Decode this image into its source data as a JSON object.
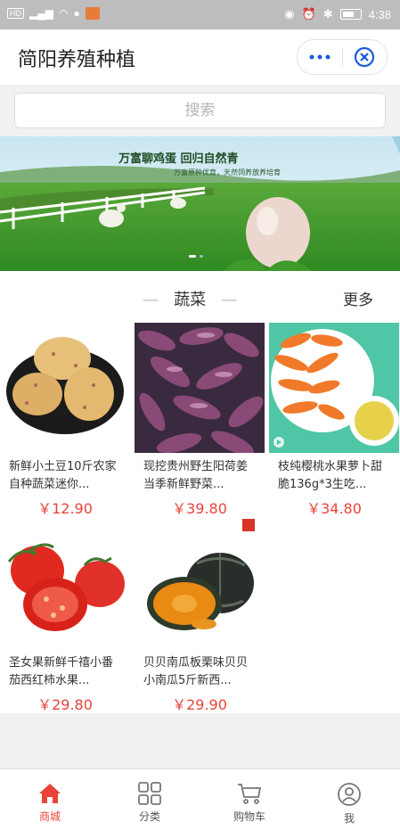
{
  "status_bar": {
    "time": "4:38",
    "left_badge": "HD"
  },
  "header": {
    "title": "简阳养殖种植",
    "more_icon": "ellipsis-icon",
    "close_icon": "close-circle-icon"
  },
  "search": {
    "placeholder": "搜索"
  },
  "banner": {
    "headline": "万富聊鸡蛋 回归自然青",
    "subline": "万富原种优育，天然饲养放养培育"
  },
  "section": {
    "title": "蔬菜",
    "more_label": "更多"
  },
  "products": [
    {
      "name": "新鲜小土豆10斤农家自种蔬菜迷你...",
      "price": "￥12.90"
    },
    {
      "name": "现挖贵州野生阳荷姜当季新鲜野菜...",
      "price": "￥39.80"
    },
    {
      "name": "枝纯樱桃水果萝卜甜脆136g*3生吃...",
      "price": "￥34.80"
    },
    {
      "name": "圣女果新鲜千禧小番茄西红柿水果...",
      "price": "￥29.80"
    },
    {
      "name": "贝贝南瓜板栗味贝贝小南瓜5斤新西...",
      "price": "￥29.90"
    }
  ],
  "tabbar": [
    {
      "label": "商城",
      "icon": "home-icon",
      "active": true
    },
    {
      "label": "分类",
      "icon": "category-grid-icon",
      "active": false
    },
    {
      "label": "购物车",
      "icon": "cart-icon",
      "active": false
    },
    {
      "label": "我",
      "icon": "profile-icon",
      "active": false
    }
  ],
  "colors": {
    "accent": "#e8443a",
    "capsule_blue": "#1a73e8"
  }
}
